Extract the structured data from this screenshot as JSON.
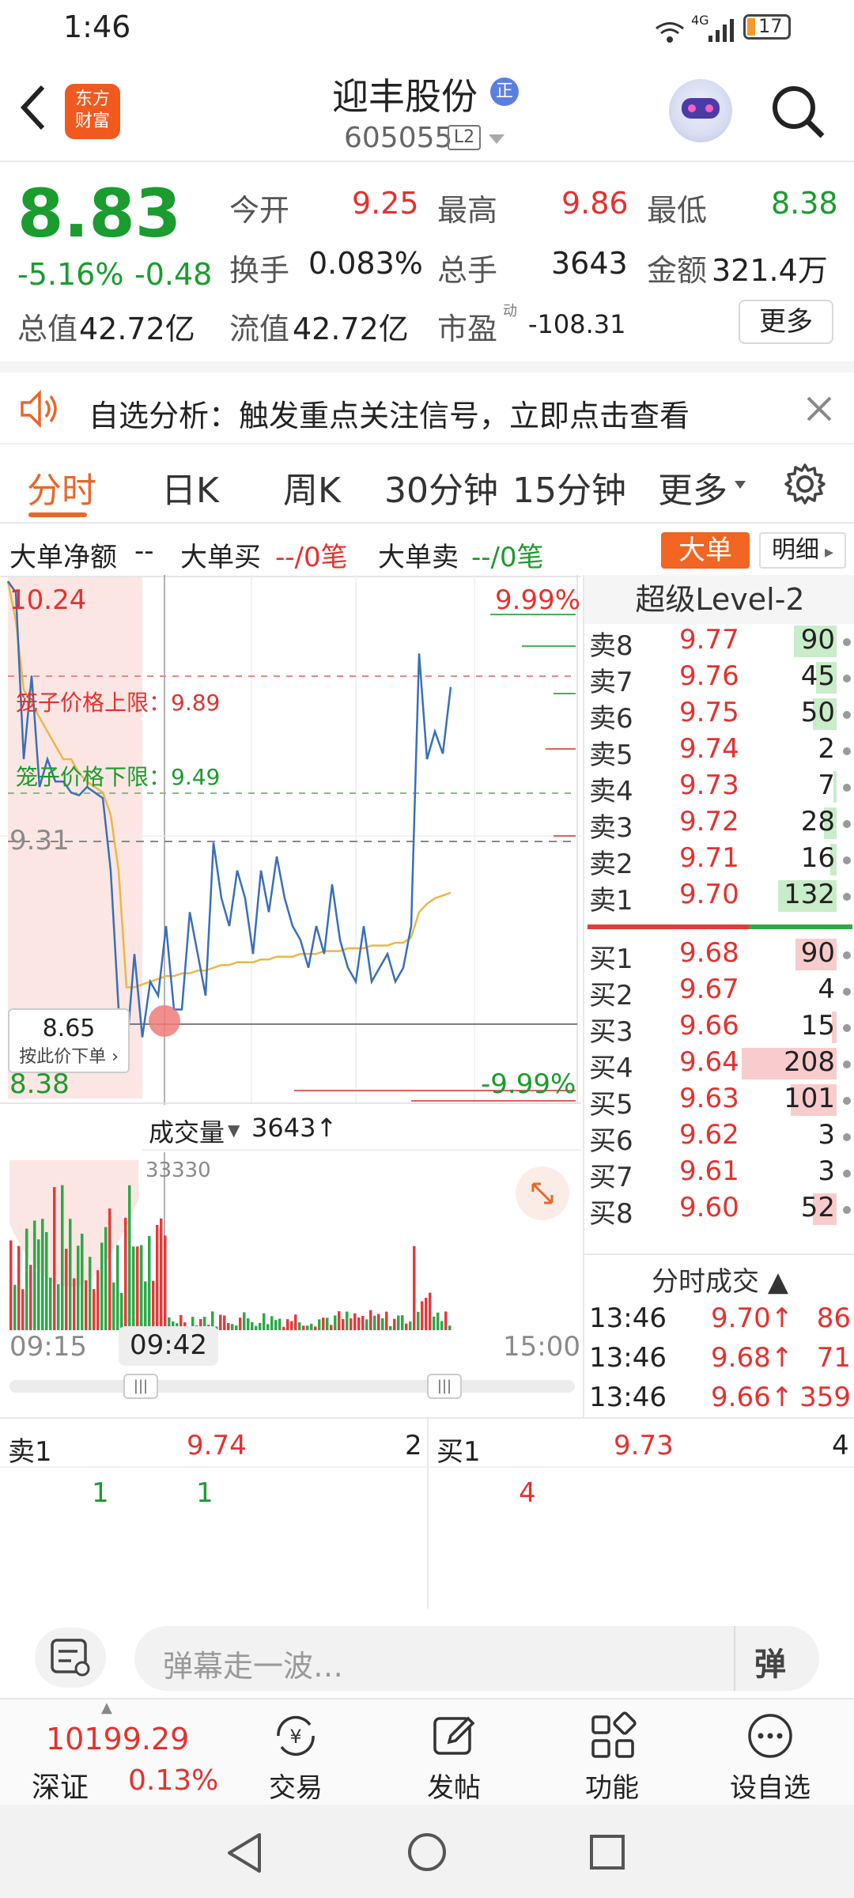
{
  "status": {
    "time": "1:46",
    "network": "4G",
    "battery": "17"
  },
  "header": {
    "logo_line1": "东方",
    "logo_line2": "财富",
    "stock_name": "迎丰股份",
    "stock_badge": "正",
    "stock_code": "605055",
    "level_badge": "L2"
  },
  "quote": {
    "price": "8.83",
    "change_pct": "-5.16%",
    "change": "-0.48",
    "open_label": "今开",
    "open": "9.25",
    "high_label": "最高",
    "high": "9.86",
    "low_label": "最低",
    "low": "8.38",
    "turnover_label": "换手",
    "turnover": "0.083%",
    "volume_label": "总手",
    "volume": "3643",
    "amount_label": "金额",
    "amount": "321.4万",
    "mktcap_label": "总值",
    "mktcap": "42.72亿",
    "float_label": "流值",
    "float": "42.72亿",
    "pe_label": "市盈",
    "pe_sup": "动",
    "pe": "-108.31",
    "more_button": "更多"
  },
  "banner": {
    "text": "自选分析：触发重点关注信号，立即点击查看"
  },
  "tabs": [
    "分时",
    "日K",
    "周K",
    "30分钟",
    "15分钟",
    "更多"
  ],
  "big_order": {
    "net_label": "大单净额",
    "net_value": "--",
    "buy_label": "大单买",
    "buy_value": "--/0笔",
    "sell_label": "大单卖",
    "sell_value": "--/0笔",
    "btn_big": "大单",
    "btn_detail": "明细"
  },
  "chart": {
    "price_top": "10.24",
    "pct_top": "9.99%",
    "cage_upper_label": "笼子价格上限：",
    "cage_upper": "9.89",
    "cage_lower_label": "笼子价格下限：",
    "cage_lower": "9.49",
    "prev_close": "9.31",
    "price_bottom": "8.38",
    "pct_bottom": "-9.99%",
    "cursor_price": "8.65",
    "cursor_hint": "按此价下单",
    "volume_label": "成交量",
    "volume_value": "3643",
    "volume_max": "33330",
    "time_start": "09:15",
    "time_cursor": "09:42",
    "time_end": "15:00"
  },
  "chart_data": {
    "type": "line",
    "ylim": [
      8.38,
      10.24
    ],
    "prev_close": 9.31,
    "price": [
      10.24,
      10.2,
      9.6,
      9.9,
      9.5,
      9.6,
      9.52,
      9.52,
      9.48,
      9.47,
      9.5,
      9.48,
      9.46,
      9.2,
      8.7,
      8.55,
      8.9,
      8.6,
      8.8,
      8.75,
      9.0,
      8.7,
      8.7,
      9.05,
      8.9,
      8.75,
      9.3,
      9.1,
      9.0,
      9.2,
      9.1,
      8.9,
      9.2,
      9.05,
      9.25,
      9.1,
      9.0,
      8.95,
      8.85,
      9.0,
      8.9,
      9.15,
      8.95,
      8.85,
      8.8,
      9.0,
      8.8,
      8.85,
      8.9,
      8.8,
      8.85,
      9.0,
      9.98,
      9.6,
      9.7,
      9.62,
      9.86
    ],
    "avg": [
      10.24,
      10.1,
      9.85,
      9.8,
      9.75,
      9.7,
      9.65,
      9.6,
      9.6,
      9.55,
      9.52,
      9.5,
      9.48,
      9.4,
      9.2,
      8.78,
      8.78,
      8.79,
      8.8,
      8.81,
      8.82,
      8.82,
      8.83,
      8.83,
      8.84,
      8.84,
      8.85,
      8.86,
      8.86,
      8.87,
      8.87,
      8.87,
      8.88,
      8.88,
      8.89,
      8.89,
      8.89,
      8.9,
      8.9,
      8.9,
      8.91,
      8.91,
      8.91,
      8.92,
      8.92,
      8.92,
      8.93,
      8.93,
      8.93,
      8.94,
      8.94,
      8.96,
      9.05,
      9.08,
      9.1,
      9.11,
      9.12
    ]
  },
  "level2": {
    "title": "超级Level-2",
    "asks": [
      {
        "label": "卖8",
        "price": "9.77",
        "vol": "90",
        "bar": 0.45
      },
      {
        "label": "卖7",
        "price": "9.76",
        "vol": "45",
        "bar": 0.22
      },
      {
        "label": "卖6",
        "price": "9.75",
        "vol": "50",
        "bar": 0.25
      },
      {
        "label": "卖5",
        "price": "9.74",
        "vol": "2",
        "bar": 0.0
      },
      {
        "label": "卖4",
        "price": "9.73",
        "vol": "7",
        "bar": 0.03
      },
      {
        "label": "卖3",
        "price": "9.72",
        "vol": "28",
        "bar": 0.13
      },
      {
        "label": "卖2",
        "price": "9.71",
        "vol": "16",
        "bar": 0.07
      },
      {
        "label": "卖1",
        "price": "9.70",
        "vol": "132",
        "bar": 0.62
      }
    ],
    "bids": [
      {
        "label": "买1",
        "price": "9.68",
        "vol": "90",
        "bar": 0.43
      },
      {
        "label": "买2",
        "price": "9.67",
        "vol": "4",
        "bar": 0.0
      },
      {
        "label": "买3",
        "price": "9.66",
        "vol": "15",
        "bar": 0.05
      },
      {
        "label": "买4",
        "price": "9.64",
        "vol": "208",
        "bar": 1.0
      },
      {
        "label": "买5",
        "price": "9.63",
        "vol": "101",
        "bar": 0.48
      },
      {
        "label": "买6",
        "price": "9.62",
        "vol": "3",
        "bar": 0.0
      },
      {
        "label": "买7",
        "price": "9.61",
        "vol": "3",
        "bar": 0.0
      },
      {
        "label": "买8",
        "price": "9.60",
        "vol": "52",
        "bar": 0.25
      }
    ],
    "ticks_title": "分时成交",
    "ticks": [
      {
        "time": "13:46",
        "price": "9.70",
        "vol": "86"
      },
      {
        "time": "13:46",
        "price": "9.68",
        "vol": "71"
      },
      {
        "time": "13:46",
        "price": "9.66",
        "vol": "359"
      }
    ]
  },
  "queue": {
    "sell_label": "卖1",
    "sell_price": "9.74",
    "sell_count": "2",
    "sell_orders": [
      "1",
      "1"
    ],
    "buy_label": "买1",
    "buy_price": "9.73",
    "buy_count": "4",
    "buy_orders": [
      "4"
    ]
  },
  "danmu": {
    "placeholder": "弹幕走一波…",
    "send_label": "弹"
  },
  "nav": {
    "index_value": "10199.29",
    "index_name": "深证",
    "index_pct": "0.13%",
    "trade": "交易",
    "post": "发帖",
    "func": "功能",
    "watch": "设自选"
  }
}
